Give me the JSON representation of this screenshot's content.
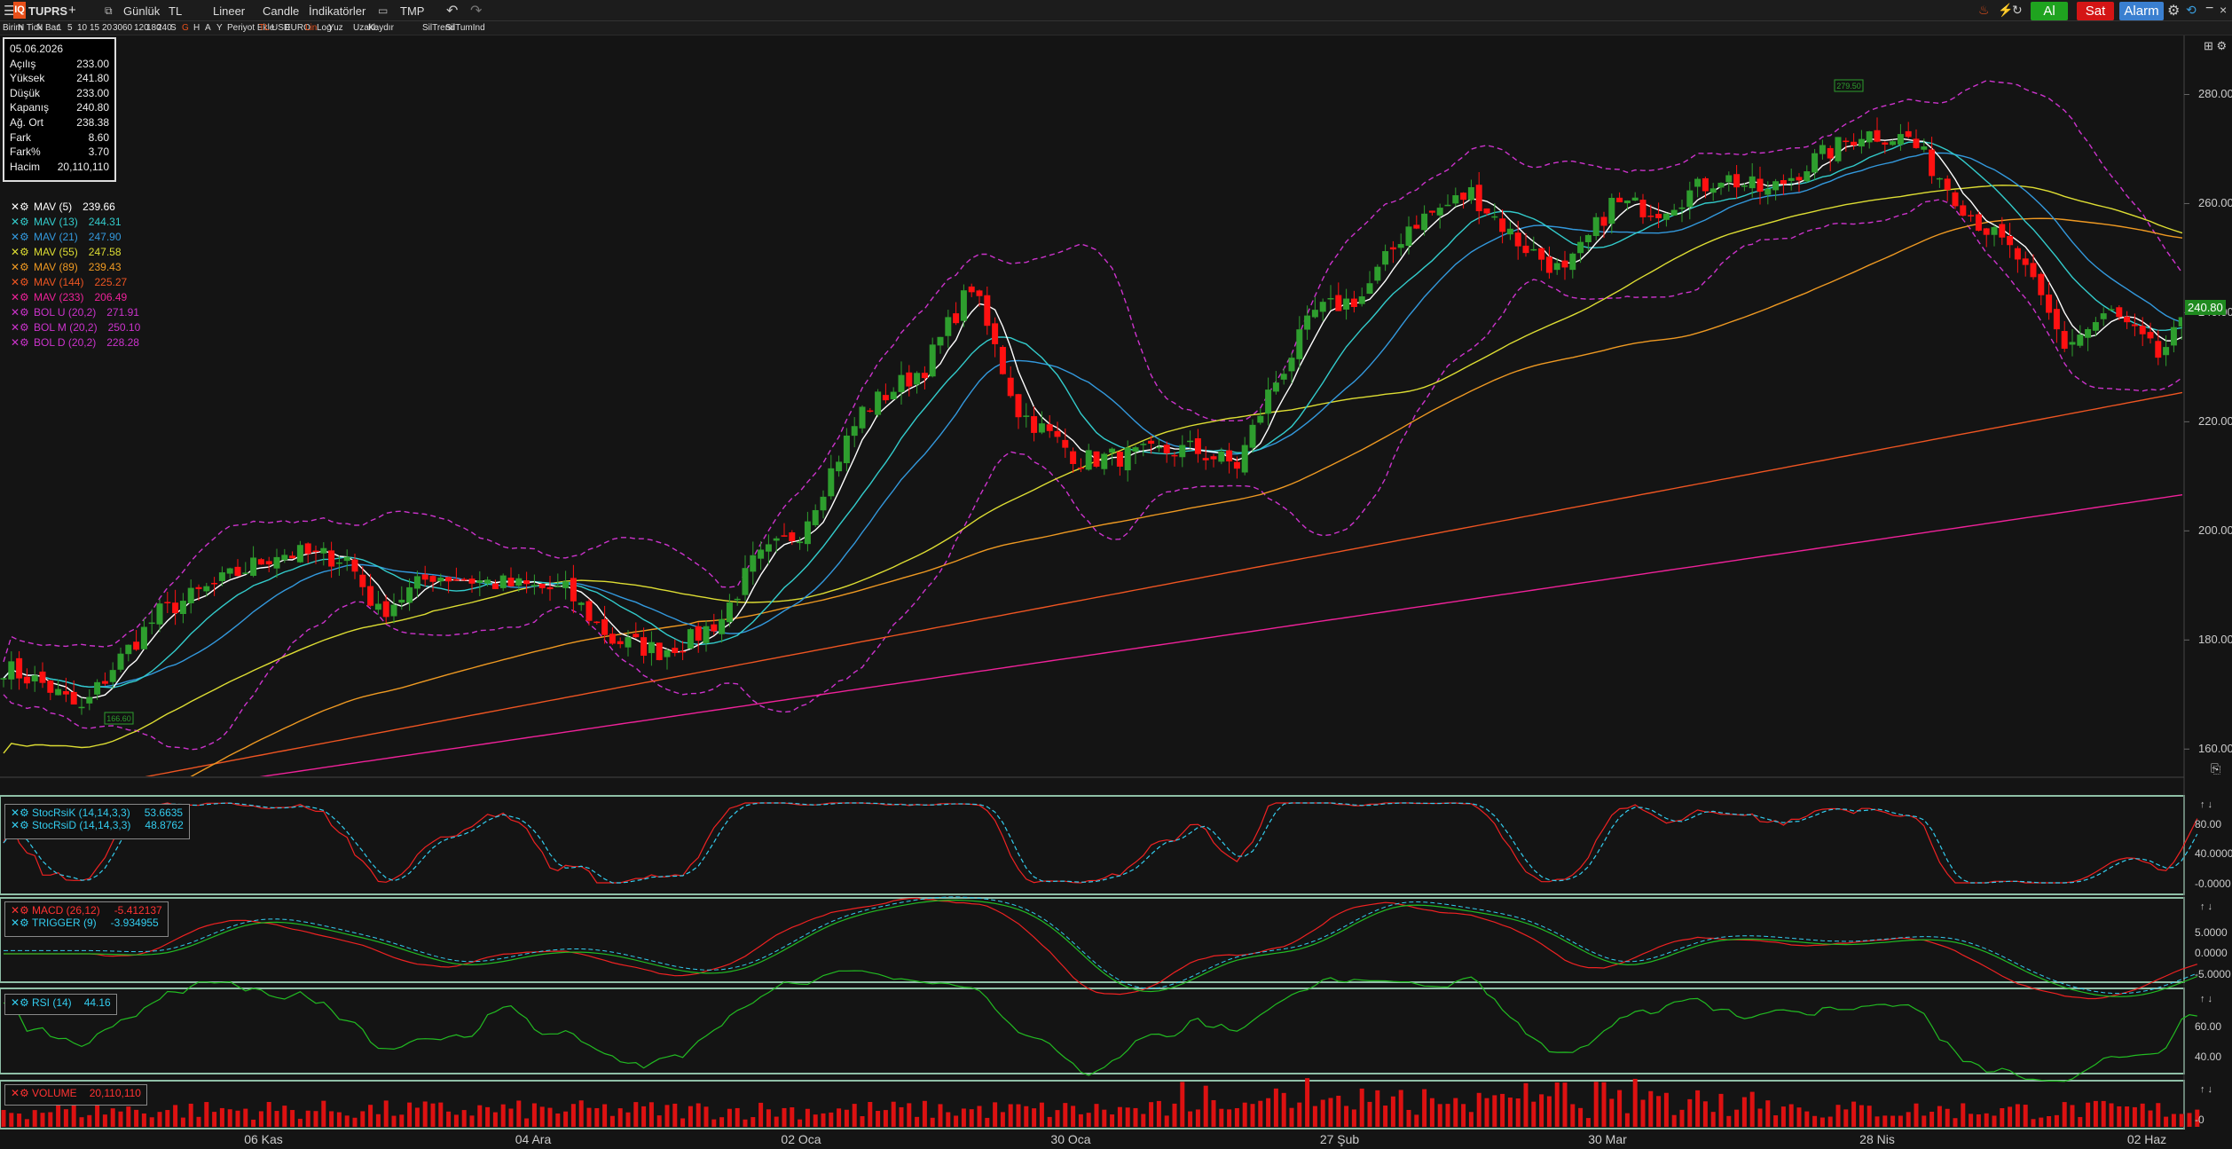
{
  "toolbar": {
    "symbol": "TUPRS",
    "add": "+",
    "period": "Günlük",
    "currency": "TL",
    "line_type": "Lineer",
    "chart_type": "Candle",
    "indicators": "İndikatörler",
    "template": "TMP",
    "buy": "Al",
    "sell": "Sat",
    "alarm": "Alarm"
  },
  "toolbar2": {
    "items": [
      "Birim",
      "N Tick",
      "N Bar",
      "1",
      "5",
      "10",
      "15",
      "20",
      "30",
      "60",
      "120",
      "180",
      "240",
      "S",
      "G",
      "H",
      "A",
      "Y",
      "Periyot Ekle",
      "TL",
      "USD",
      "EURO",
      "Lin",
      "Log",
      "Yuz",
      "Uzakl.",
      "Kaydır",
      "SilTrend",
      "SilTumInd"
    ]
  },
  "ohlc": {
    "rows": [
      {
        "k": "05.06.2026",
        "v": ""
      },
      {
        "k": "Açılış",
        "v": "233.00"
      },
      {
        "k": "Yüksek",
        "v": "241.80"
      },
      {
        "k": "Düşük",
        "v": "233.00"
      },
      {
        "k": "Kapanış",
        "v": "240.80"
      },
      {
        "k": "Ağ. Ort",
        "v": "238.38"
      },
      {
        "k": "Fark",
        "v": "8.60"
      },
      {
        "k": "Fark%",
        "v": "3.70"
      },
      {
        "k": "Hacim",
        "v": "20,110,110"
      }
    ]
  },
  "legend": [
    {
      "name": "MAV (5)",
      "value": "239.66",
      "color": "#ffffff"
    },
    {
      "name": "MAV (13)",
      "value": "244.31",
      "color": "#33cccc"
    },
    {
      "name": "MAV (21)",
      "value": "247.90",
      "color": "#3399dd"
    },
    {
      "name": "MAV (55)",
      "value": "247.58",
      "color": "#dddd33"
    },
    {
      "name": "MAV (89)",
      "value": "239.43",
      "color": "#ee9922"
    },
    {
      "name": "MAV (144)",
      "value": "225.27",
      "color": "#ee5522"
    },
    {
      "name": "MAV (233)",
      "value": "206.49",
      "color": "#ee2299"
    },
    {
      "name": "BOL U (20,2)",
      "value": "271.91",
      "color": "#cc33cc"
    },
    {
      "name": "BOL M (20,2)",
      "value": "250.10",
      "color": "#cc33cc"
    },
    {
      "name": "BOL D (20,2)",
      "value": "228.28",
      "color": "#cc33cc"
    }
  ],
  "y_axis": {
    "labels": [
      "280.00",
      "260.00",
      "240.00",
      "220.00",
      "200.00",
      "180.00",
      "160.00"
    ],
    "last_price": "240.80"
  },
  "x_axis": {
    "labels": [
      "06 Kas",
      "04 Ara",
      "02 Oca",
      "30 Oca",
      "27 Şub",
      "30 Mar",
      "28 Nis",
      "02 Haz"
    ]
  },
  "markers": {
    "high": "279.50",
    "low": "166.60"
  },
  "panels": {
    "stochrsi": {
      "k_name": "StocRsiK (14,14,3,3)",
      "k_value": "53.6635",
      "d_name": "StocRsiD (14,14,3,3)",
      "d_value": "48.8762",
      "axis": [
        "80.00",
        "40.0000",
        "-0.0000"
      ]
    },
    "macd": {
      "macd_name": "MACD (26,12)",
      "macd_value": "-5.412137",
      "trig_name": "TRIGGER (9)",
      "trig_value": "-3.934955",
      "axis": [
        "5.0000",
        "0.0000",
        "-5.0000"
      ]
    },
    "rsi": {
      "name": "RSI (14)",
      "value": "44.16",
      "axis": [
        "60.00",
        "40.00"
      ]
    },
    "volume": {
      "name": "VOLUME",
      "value": "20,110,110",
      "axis": [
        "-0"
      ]
    }
  },
  "colors": {
    "up": "#2e9e2e",
    "down": "#ff1111",
    "buy": "#1fa31f",
    "sell": "#d41515",
    "alarm": "#3a7fd0"
  },
  "chart_data": {
    "type": "candlestick",
    "ylim": [
      155,
      290
    ],
    "series": [
      "MAV (5)",
      "MAV (13)",
      "MAV (21)",
      "MAV (55)",
      "MAV (89)",
      "MAV (144)",
      "MAV (233)",
      "BOL U (20,2)",
      "BOL M (20,2)",
      "BOL D (20,2)"
    ],
    "x_labels": [
      "06 Kas",
      "04 Ara",
      "02 Oca",
      "30 Oca",
      "27 Şub",
      "30 Mar",
      "28 Nis",
      "02 Haz"
    ],
    "close_waypoints": [
      [
        0,
        175
      ],
      [
        5,
        172
      ],
      [
        10,
        167
      ],
      [
        14,
        175
      ],
      [
        20,
        185
      ],
      [
        27,
        190
      ],
      [
        35,
        196
      ],
      [
        44,
        195
      ],
      [
        48,
        185
      ],
      [
        55,
        192
      ],
      [
        65,
        190
      ],
      [
        72,
        189
      ],
      [
        78,
        180
      ],
      [
        84,
        178
      ],
      [
        88,
        180
      ],
      [
        92,
        184
      ],
      [
        96,
        194
      ],
      [
        102,
        200
      ],
      [
        110,
        222
      ],
      [
        118,
        230
      ],
      [
        124,
        245
      ],
      [
        130,
        222
      ],
      [
        138,
        213
      ],
      [
        146,
        214
      ],
      [
        152,
        215
      ],
      [
        158,
        212
      ],
      [
        162,
        225
      ],
      [
        168,
        240
      ],
      [
        174,
        243
      ],
      [
        180,
        256
      ],
      [
        188,
        262
      ],
      [
        194,
        253
      ],
      [
        200,
        247
      ],
      [
        206,
        260
      ],
      [
        212,
        259
      ],
      [
        220,
        265
      ],
      [
        226,
        262
      ],
      [
        232,
        268
      ],
      [
        238,
        273
      ],
      [
        244,
        272
      ],
      [
        252,
        258
      ],
      [
        258,
        250
      ],
      [
        264,
        234
      ],
      [
        270,
        240
      ],
      [
        276,
        232
      ],
      [
        281,
        240.8
      ]
    ],
    "volume_note": "daily volume bars",
    "last": {
      "date": "05.06.2026",
      "open": 233.0,
      "high": 241.8,
      "low": 233.0,
      "close": 240.8
    }
  }
}
